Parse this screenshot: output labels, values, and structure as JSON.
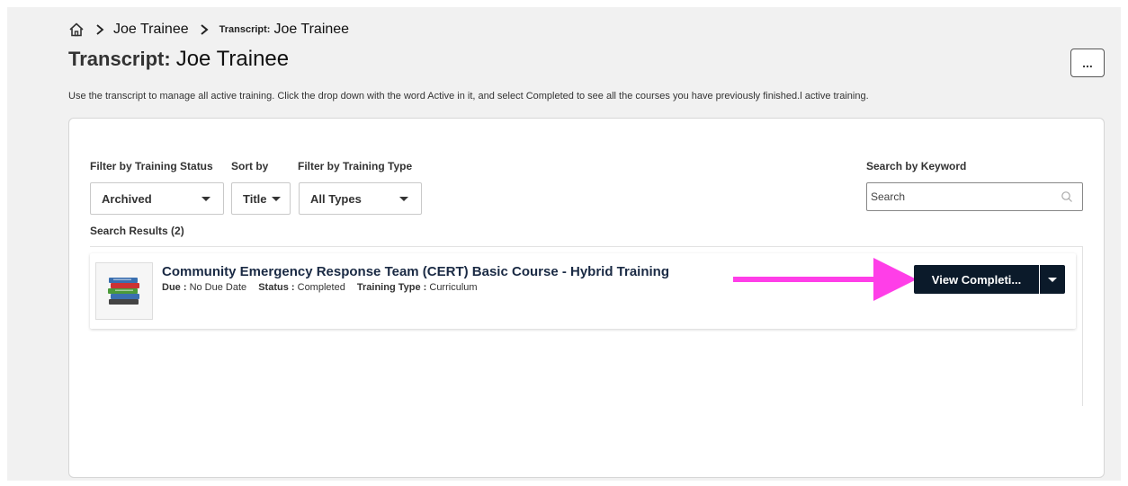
{
  "breadcrumb": {
    "home_icon": "home-icon",
    "item1": "Joe Trainee",
    "item2_prefix": "Transcript:",
    "item2_name": "Joe Trainee"
  },
  "header": {
    "title_label": "Transcript:",
    "title_name": "Joe Trainee",
    "more_label": "..."
  },
  "intro_text": "Use the transcript to manage all active training. Click the drop down with the word Active in it, and select Completed to see all the courses you have previously finished.l active training.",
  "filters": {
    "status_label": "Filter by Training Status",
    "status_value": "Archived",
    "sort_label": "Sort by",
    "sort_value": "Title",
    "type_label": "Filter by Training Type",
    "type_value": "All Types",
    "keyword_label": "Search by Keyword",
    "keyword_placeholder": "Search"
  },
  "results": {
    "label": "Search Results (2)",
    "items": [
      {
        "title": "Community Emergency Response Team (CERT) Basic Course - Hybrid Training",
        "due_label": "Due :",
        "due_value": "No Due Date",
        "status_label": "Status :",
        "status_value": "Completed",
        "type_label": "Training Type :",
        "type_value": "Curriculum",
        "action_label": "View Completi...",
        "thumbnail_icon": "books-icon"
      }
    ]
  },
  "colors": {
    "accent_dark": "#0b1a2a",
    "arrow": "#ff3ee8",
    "title_text": "#1a2a44"
  }
}
